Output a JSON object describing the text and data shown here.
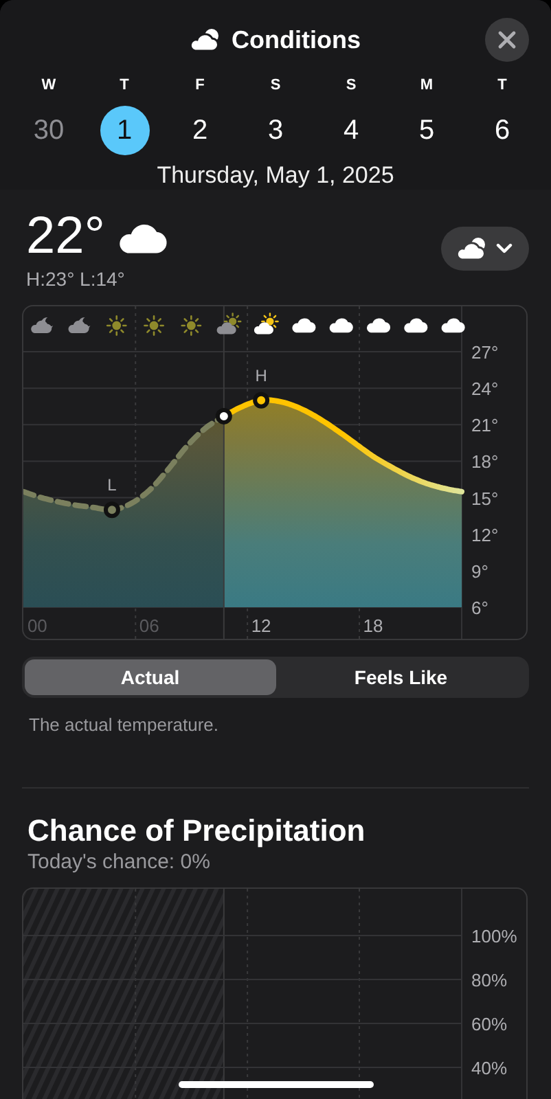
{
  "header": {
    "title": "Conditions"
  },
  "days": [
    {
      "weekday": "W",
      "date": "30",
      "selected": false,
      "past": true
    },
    {
      "weekday": "T",
      "date": "1",
      "selected": true,
      "past": false
    },
    {
      "weekday": "F",
      "date": "2",
      "selected": false,
      "past": false
    },
    {
      "weekday": "S",
      "date": "3",
      "selected": false,
      "past": false
    },
    {
      "weekday": "S",
      "date": "4",
      "selected": false,
      "past": false
    },
    {
      "weekday": "M",
      "date": "5",
      "selected": false,
      "past": false
    },
    {
      "weekday": "T",
      "date": "6",
      "selected": false,
      "past": false
    }
  ],
  "date_label": "Thursday, May 1, 2025",
  "current": {
    "temperature": "22°",
    "high_low": "H:23° L:14°"
  },
  "temperature_chart": {
    "hourly_conditions": [
      {
        "kind": "cloud-moon",
        "past": true
      },
      {
        "kind": "cloud-moon",
        "past": true
      },
      {
        "kind": "sun",
        "past": true
      },
      {
        "kind": "sun",
        "past": true
      },
      {
        "kind": "sun",
        "past": true
      },
      {
        "kind": "sun-cloud",
        "past": true
      },
      {
        "kind": "sun-cloud",
        "past": false
      },
      {
        "kind": "cloud",
        "past": false
      },
      {
        "kind": "cloud",
        "past": false
      },
      {
        "kind": "cloud",
        "past": false
      },
      {
        "kind": "cloud",
        "past": false
      },
      {
        "kind": "cloud",
        "past": false
      }
    ],
    "low_label": "L",
    "high_label": "H",
    "chart_data": {
      "type": "area",
      "grid": true,
      "x": [
        -0.75,
        0,
        1,
        2,
        3,
        4,
        5,
        6,
        7,
        8,
        9,
        10,
        11,
        12,
        13,
        14,
        15,
        16,
        17,
        18,
        19,
        20,
        21,
        22,
        22.75
      ],
      "series": [
        {
          "color": "#7b805e",
          "values": [
            15.5,
            15.1,
            14.7,
            14.4,
            14.2,
            14.0,
            14.5,
            15.6,
            17.3,
            19.2,
            20.7,
            21.7,
            null,
            null,
            null,
            null,
            null,
            null,
            null,
            null,
            null,
            null,
            null,
            null,
            null
          ]
        },
        {
          "color": "#ffc400",
          "values": [
            null,
            null,
            null,
            null,
            null,
            null,
            null,
            null,
            null,
            null,
            null,
            21.7,
            22.5,
            23.0,
            22.9,
            22.4,
            21.6,
            20.6,
            19.5,
            18.4,
            17.5,
            16.7,
            16.1,
            15.7,
            15.5
          ]
        }
      ],
      "xlim": [
        -0.75,
        22.75
      ],
      "ylim": [
        6,
        27
      ],
      "ref_lines": [
        {
          "axis": "x",
          "value": 10
        }
      ],
      "xticks": [
        {
          "value": 0,
          "label": "00"
        },
        {
          "value": 6,
          "label": "06"
        },
        {
          "value": 12,
          "label": "12"
        },
        {
          "value": 18,
          "label": "18"
        }
      ],
      "yticks": [
        {
          "value": 27,
          "label": "27°"
        },
        {
          "value": 24,
          "label": "24°"
        },
        {
          "value": 21,
          "label": "21°"
        },
        {
          "value": 18,
          "label": "18°"
        },
        {
          "value": 15,
          "label": "15°"
        },
        {
          "value": 12,
          "label": "12°"
        },
        {
          "value": 9,
          "label": "9°"
        },
        {
          "value": 6,
          "label": "6°"
        }
      ]
    }
  },
  "view_tabs": [
    {
      "label": "Actual",
      "selected": true
    },
    {
      "label": "Feels Like",
      "selected": false
    }
  ],
  "description": "The actual temperature.",
  "precipitation": {
    "title": "Chance of Precipitation",
    "summary": "Today's chance: 0%",
    "chart_data": {
      "type": "bar",
      "grid": true,
      "xlim": [
        -0.75,
        22.75
      ],
      "ylim": [
        15,
        100
      ],
      "ref_lines": [
        {
          "axis": "x",
          "value": 10
        }
      ],
      "yticks": [
        {
          "value": 100,
          "label": "100%"
        },
        {
          "value": 80,
          "label": "80%"
        },
        {
          "value": 60,
          "label": "60%"
        },
        {
          "value": 40,
          "label": "40%"
        }
      ]
    }
  }
}
